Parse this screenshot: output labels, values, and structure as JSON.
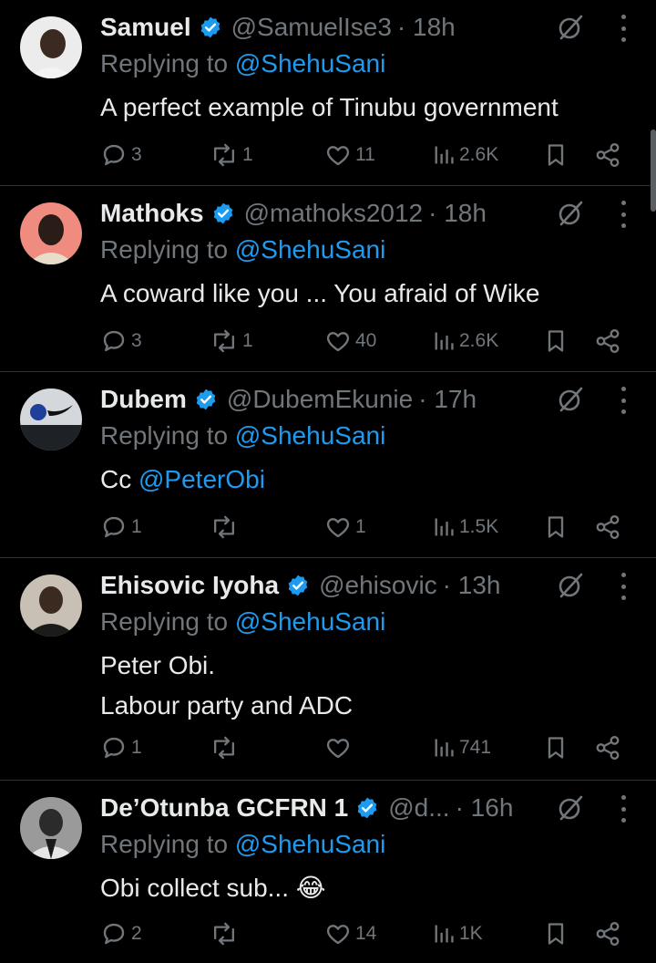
{
  "replying_prefix": "Replying to",
  "replies": [
    {
      "name": "Samuel",
      "handle": "@SamuelIse3",
      "time": "· 18h",
      "replying_to": "@ShehuSani",
      "text_lines": [
        "A perfect example of Tinubu government"
      ],
      "mention_text": "",
      "emoji": "",
      "counts": {
        "reply": "3",
        "repost": "1",
        "like": "11",
        "views": "2.6K"
      },
      "avatar_bg": "#e9e9e9"
    },
    {
      "name": "Mathoks",
      "handle": "@mathoks2012",
      "time": "· 18h",
      "replying_to": "@ShehuSani",
      "text_lines": [
        "A coward like you ... You afraid of Wike"
      ],
      "mention_text": "",
      "emoji": "",
      "counts": {
        "reply": "3",
        "repost": "1",
        "like": "40",
        "views": "2.6K"
      },
      "avatar_bg": "#ef8c7f"
    },
    {
      "name": "Dubem",
      "handle": "@DubemEkunie",
      "time": "· 17h",
      "replying_to": "@ShehuSani",
      "text_lines": [
        "Cc "
      ],
      "mention_text": "@PeterObi",
      "emoji": "",
      "counts": {
        "reply": "1",
        "repost": "",
        "like": "1",
        "views": "1.5K"
      },
      "avatar_bg": "#cfd3d8"
    },
    {
      "name": "Ehisovic Iyoha",
      "handle": "@ehisovic",
      "time": "· 13h",
      "replying_to": "@ShehuSani",
      "text_lines": [
        "Peter Obi.",
        "Labour party and ADC"
      ],
      "mention_text": "",
      "emoji": "",
      "counts": {
        "reply": "1",
        "repost": "",
        "like": "",
        "views": "741"
      },
      "avatar_bg": "#c9c2b8"
    },
    {
      "name": "De’Otunba GCFRN 1",
      "handle": "@d...",
      "time": "· 16h",
      "replying_to": "@ShehuSani",
      "text_lines": [
        "Obi collect sub... "
      ],
      "mention_text": "",
      "emoji": "😂",
      "counts": {
        "reply": "2",
        "repost": "",
        "like": "14",
        "views": "1K"
      },
      "avatar_bg": "#8a8a8a"
    }
  ],
  "colors": {
    "background": "#000000",
    "text": "#e7e9ea",
    "muted": "#71767b",
    "accent": "#1d9bf0",
    "divider": "#2f3336"
  },
  "icons": [
    "verified-badge-icon",
    "grok-icon",
    "more-icon",
    "reply-icon",
    "repost-icon",
    "like-icon",
    "views-icon",
    "bookmark-icon",
    "share-icon"
  ]
}
